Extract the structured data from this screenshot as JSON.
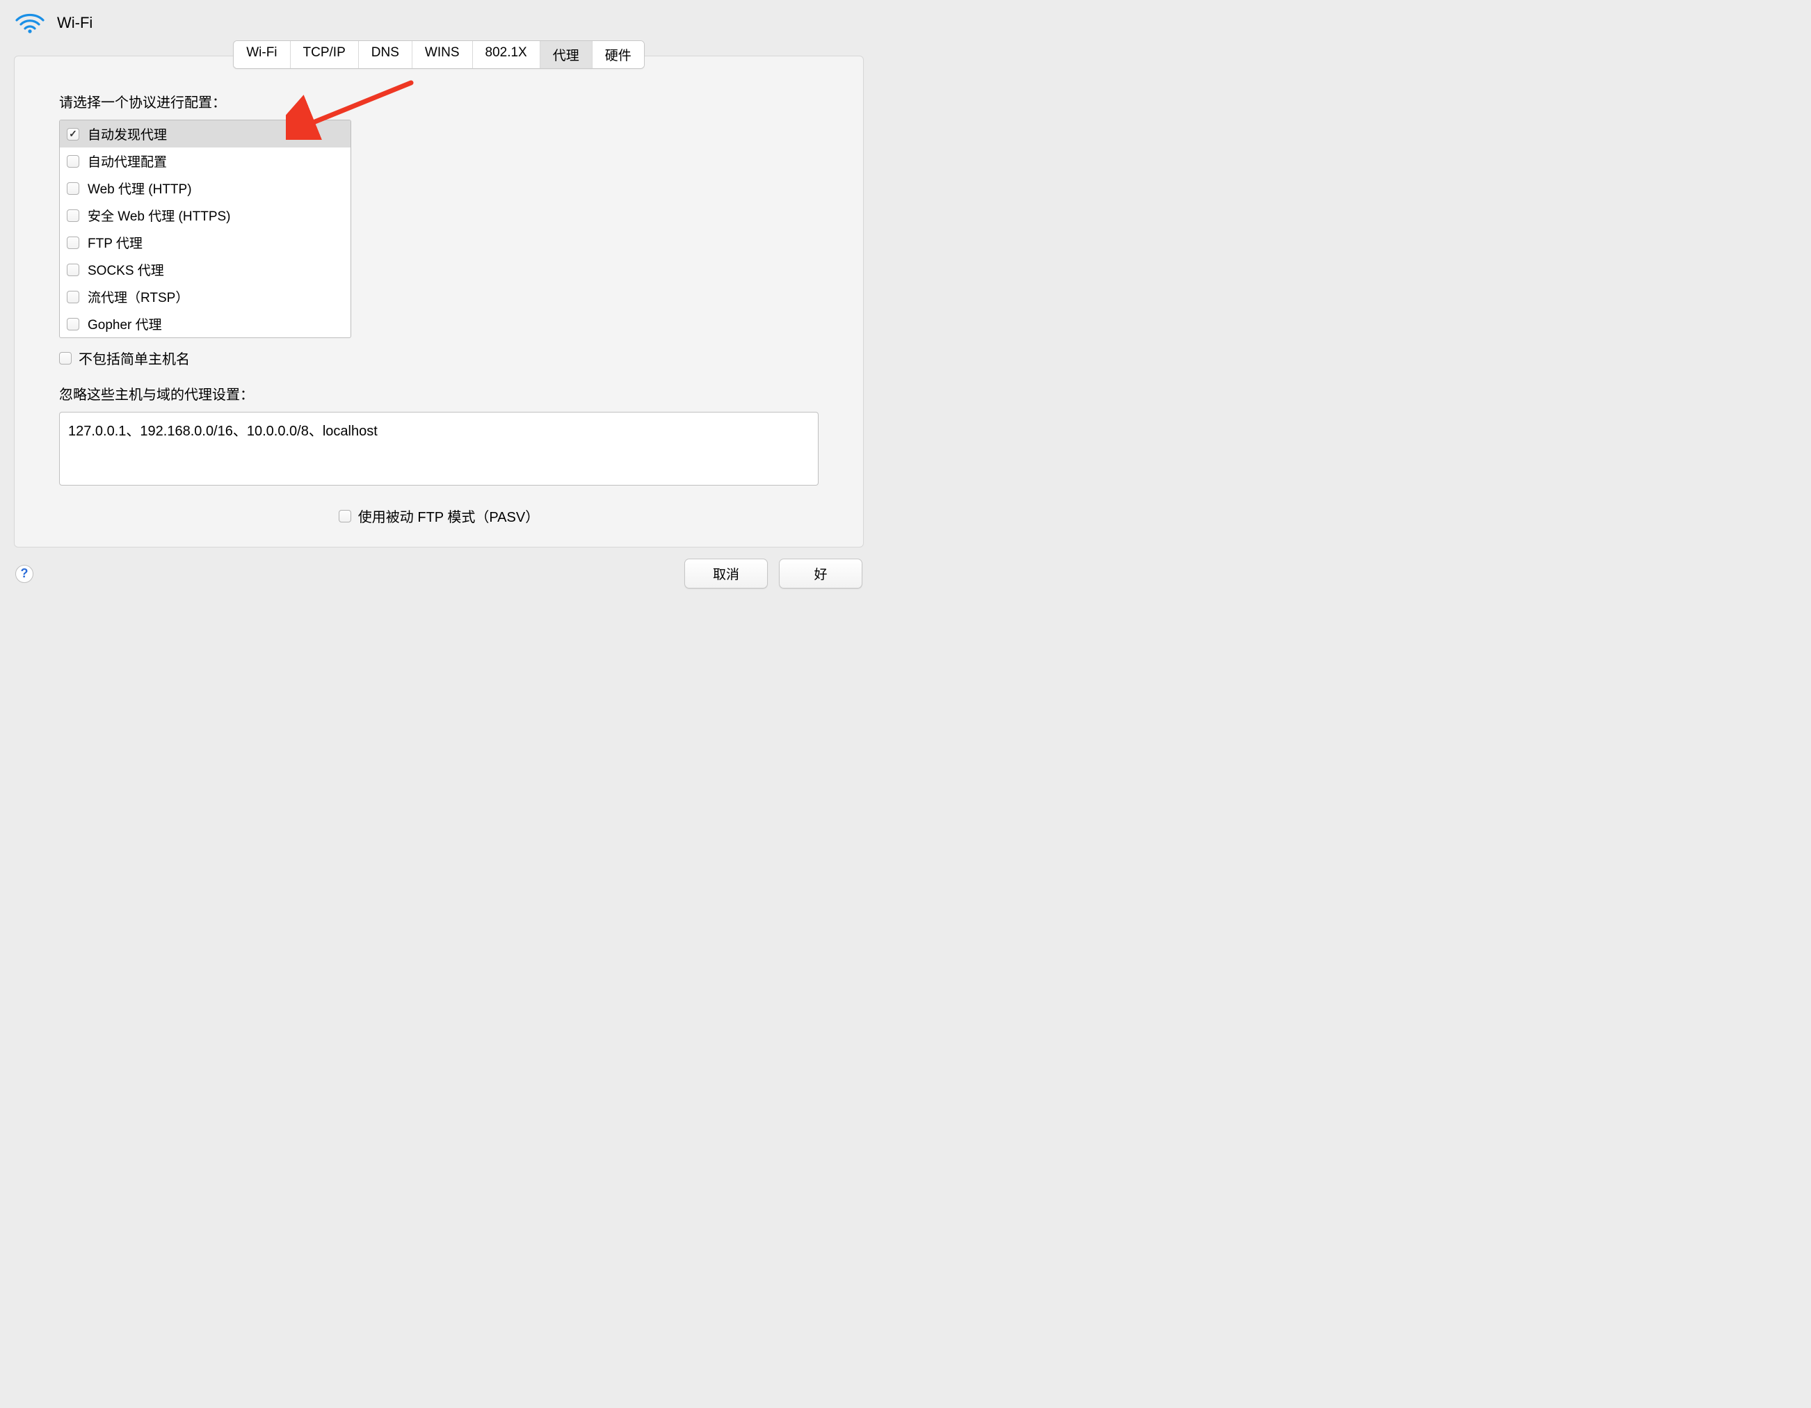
{
  "header": {
    "title": "Wi-Fi"
  },
  "tabs": [
    {
      "label": "Wi-Fi",
      "active": false
    },
    {
      "label": "TCP/IP",
      "active": false
    },
    {
      "label": "DNS",
      "active": false
    },
    {
      "label": "WINS",
      "active": false
    },
    {
      "label": "802.1X",
      "active": false
    },
    {
      "label": "代理",
      "active": true
    },
    {
      "label": "硬件",
      "active": false
    }
  ],
  "labels": {
    "protocol_prompt": "请选择一个协议进行配置：",
    "exclude_simple": "不包括简单主机名",
    "bypass_label": "忽略这些主机与域的代理设置：",
    "pasv_label": "使用被动 FTP 模式（PASV）"
  },
  "protocols": [
    {
      "label": "自动发现代理",
      "checked": true,
      "selected": true
    },
    {
      "label": "自动代理配置",
      "checked": false,
      "selected": false
    },
    {
      "label": "Web 代理 (HTTP)",
      "checked": false,
      "selected": false
    },
    {
      "label": "安全 Web 代理 (HTTPS)",
      "checked": false,
      "selected": false
    },
    {
      "label": "FTP 代理",
      "checked": false,
      "selected": false
    },
    {
      "label": "SOCKS 代理",
      "checked": false,
      "selected": false
    },
    {
      "label": "流代理（RTSP）",
      "checked": false,
      "selected": false
    },
    {
      "label": "Gopher 代理",
      "checked": false,
      "selected": false
    }
  ],
  "bypass_value": "127.0.0.1、192.168.0.0/16、10.0.0.0/8、localhost",
  "exclude_simple_checked": false,
  "pasv_checked": false,
  "buttons": {
    "cancel": "取消",
    "ok": "好",
    "help": "?"
  },
  "annotation": {
    "arrow_color": "#ee3723"
  }
}
